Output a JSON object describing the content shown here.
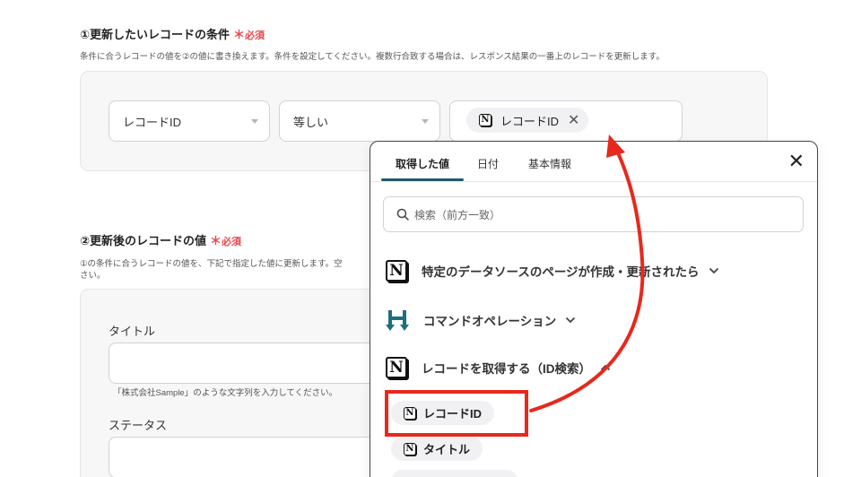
{
  "section1": {
    "title": "①更新したいレコードの条件",
    "required": "必須",
    "description": "条件に合うレコードの値を②の値に書き換えます。条件を設定してください。複数行合致する場合は、レスポンス結果の一番上のレコードを更新します。",
    "field_select": "レコードID",
    "operator_select": "等しい",
    "value_chip": "レコードID"
  },
  "section2": {
    "title": "②更新後のレコードの値",
    "required": "必須",
    "description_line1": "①の条件に合うレコードの値を、下記で指定した値に更新します。空",
    "description_line2": "さい。",
    "title_label": "タイトル",
    "title_hint": "「株式会社Sample」のような文字列を入力してください。",
    "status_label": "ステータス"
  },
  "popup": {
    "tabs": [
      "取得した値",
      "日付",
      "基本情報"
    ],
    "search_placeholder": "検索（前方一致）",
    "groups": [
      {
        "label": "特定のデータソースのページが作成・更新されたら",
        "icon": "notion-icon"
      },
      {
        "label": "コマンドオペレーション",
        "icon": "command-operation-icon"
      },
      {
        "label": "レコードを取得する（ID検索）",
        "icon": "notion-icon"
      }
    ],
    "options": [
      "レコードID",
      "タイトル"
    ]
  },
  "colors": {
    "required_red": "#e5484d",
    "tab_underline": "#1f5a67",
    "highlight_red": "#e8281c",
    "command_icon_teal": "#1f6e80"
  }
}
